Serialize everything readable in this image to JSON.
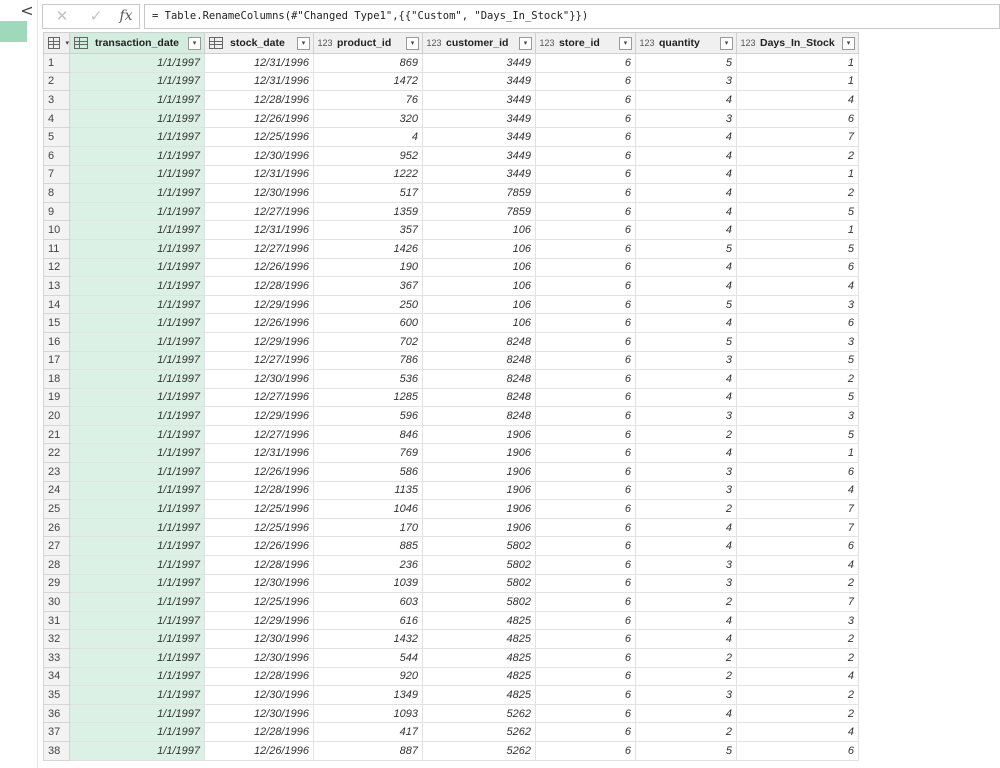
{
  "left_pane": {
    "collapse_glyph": "<"
  },
  "formula_bar": {
    "cancel_icon": "close-icon",
    "commit_icon": "check-icon",
    "fx_label": "fx",
    "formula": "= Table.RenameColumns(#\"Changed Type1\",{{\"Custom\", \"Days_In_Stock\"}})"
  },
  "columns": [
    {
      "name": "transaction_date",
      "type_icon": "date-table-icon"
    },
    {
      "name": "stock_date",
      "type_icon": "date-table-icon"
    },
    {
      "name": "product_id",
      "type_icon": "123"
    },
    {
      "name": "customer_id",
      "type_icon": "123"
    },
    {
      "name": "store_id",
      "type_icon": "123"
    },
    {
      "name": "quantity",
      "type_icon": "123"
    },
    {
      "name": "Days_In_Stock",
      "type_icon": "123"
    }
  ],
  "rows": [
    {
      "n": "1",
      "c": [
        "1/1/1997",
        "12/31/1996",
        "869",
        "3449",
        "6",
        "5",
        "1"
      ]
    },
    {
      "n": "2",
      "c": [
        "1/1/1997",
        "12/31/1996",
        "1472",
        "3449",
        "6",
        "3",
        "1"
      ]
    },
    {
      "n": "3",
      "c": [
        "1/1/1997",
        "12/28/1996",
        "76",
        "3449",
        "6",
        "4",
        "4"
      ]
    },
    {
      "n": "4",
      "c": [
        "1/1/1997",
        "12/26/1996",
        "320",
        "3449",
        "6",
        "3",
        "6"
      ]
    },
    {
      "n": "5",
      "c": [
        "1/1/1997",
        "12/25/1996",
        "4",
        "3449",
        "6",
        "4",
        "7"
      ]
    },
    {
      "n": "6",
      "c": [
        "1/1/1997",
        "12/30/1996",
        "952",
        "3449",
        "6",
        "4",
        "2"
      ]
    },
    {
      "n": "7",
      "c": [
        "1/1/1997",
        "12/31/1996",
        "1222",
        "3449",
        "6",
        "4",
        "1"
      ]
    },
    {
      "n": "8",
      "c": [
        "1/1/1997",
        "12/30/1996",
        "517",
        "7859",
        "6",
        "4",
        "2"
      ]
    },
    {
      "n": "9",
      "c": [
        "1/1/1997",
        "12/27/1996",
        "1359",
        "7859",
        "6",
        "4",
        "5"
      ]
    },
    {
      "n": "10",
      "c": [
        "1/1/1997",
        "12/31/1996",
        "357",
        "106",
        "6",
        "4",
        "1"
      ]
    },
    {
      "n": "11",
      "c": [
        "1/1/1997",
        "12/27/1996",
        "1426",
        "106",
        "6",
        "5",
        "5"
      ]
    },
    {
      "n": "12",
      "c": [
        "1/1/1997",
        "12/26/1996",
        "190",
        "106",
        "6",
        "4",
        "6"
      ]
    },
    {
      "n": "13",
      "c": [
        "1/1/1997",
        "12/28/1996",
        "367",
        "106",
        "6",
        "4",
        "4"
      ]
    },
    {
      "n": "14",
      "c": [
        "1/1/1997",
        "12/29/1996",
        "250",
        "106",
        "6",
        "5",
        "3"
      ]
    },
    {
      "n": "15",
      "c": [
        "1/1/1997",
        "12/26/1996",
        "600",
        "106",
        "6",
        "4",
        "6"
      ]
    },
    {
      "n": "16",
      "c": [
        "1/1/1997",
        "12/29/1996",
        "702",
        "8248",
        "6",
        "5",
        "3"
      ]
    },
    {
      "n": "17",
      "c": [
        "1/1/1997",
        "12/27/1996",
        "786",
        "8248",
        "6",
        "3",
        "5"
      ]
    },
    {
      "n": "18",
      "c": [
        "1/1/1997",
        "12/30/1996",
        "536",
        "8248",
        "6",
        "4",
        "2"
      ]
    },
    {
      "n": "19",
      "c": [
        "1/1/1997",
        "12/27/1996",
        "1285",
        "8248",
        "6",
        "4",
        "5"
      ]
    },
    {
      "n": "20",
      "c": [
        "1/1/1997",
        "12/29/1996",
        "596",
        "8248",
        "6",
        "3",
        "3"
      ]
    },
    {
      "n": "21",
      "c": [
        "1/1/1997",
        "12/27/1996",
        "846",
        "1906",
        "6",
        "2",
        "5"
      ]
    },
    {
      "n": "22",
      "c": [
        "1/1/1997",
        "12/31/1996",
        "769",
        "1906",
        "6",
        "4",
        "1"
      ]
    },
    {
      "n": "23",
      "c": [
        "1/1/1997",
        "12/26/1996",
        "586",
        "1906",
        "6",
        "3",
        "6"
      ]
    },
    {
      "n": "24",
      "c": [
        "1/1/1997",
        "12/28/1996",
        "1135",
        "1906",
        "6",
        "3",
        "4"
      ]
    },
    {
      "n": "25",
      "c": [
        "1/1/1997",
        "12/25/1996",
        "1046",
        "1906",
        "6",
        "2",
        "7"
      ]
    },
    {
      "n": "26",
      "c": [
        "1/1/1997",
        "12/25/1996",
        "170",
        "1906",
        "6",
        "4",
        "7"
      ]
    },
    {
      "n": "27",
      "c": [
        "1/1/1997",
        "12/26/1996",
        "885",
        "5802",
        "6",
        "4",
        "6"
      ]
    },
    {
      "n": "28",
      "c": [
        "1/1/1997",
        "12/28/1996",
        "236",
        "5802",
        "6",
        "3",
        "4"
      ]
    },
    {
      "n": "29",
      "c": [
        "1/1/1997",
        "12/30/1996",
        "1039",
        "5802",
        "6",
        "3",
        "2"
      ]
    },
    {
      "n": "30",
      "c": [
        "1/1/1997",
        "12/25/1996",
        "603",
        "5802",
        "6",
        "2",
        "7"
      ]
    },
    {
      "n": "31",
      "c": [
        "1/1/1997",
        "12/29/1996",
        "616",
        "4825",
        "6",
        "4",
        "3"
      ]
    },
    {
      "n": "32",
      "c": [
        "1/1/1997",
        "12/30/1996",
        "1432",
        "4825",
        "6",
        "4",
        "2"
      ]
    },
    {
      "n": "33",
      "c": [
        "1/1/1997",
        "12/30/1996",
        "544",
        "4825",
        "6",
        "2",
        "2"
      ]
    },
    {
      "n": "34",
      "c": [
        "1/1/1997",
        "12/28/1996",
        "920",
        "4825",
        "6",
        "2",
        "4"
      ]
    },
    {
      "n": "35",
      "c": [
        "1/1/1997",
        "12/30/1996",
        "1349",
        "4825",
        "6",
        "3",
        "2"
      ]
    },
    {
      "n": "36",
      "c": [
        "1/1/1997",
        "12/30/1996",
        "1093",
        "5262",
        "6",
        "4",
        "2"
      ]
    },
    {
      "n": "37",
      "c": [
        "1/1/1997",
        "12/28/1996",
        "417",
        "5262",
        "6",
        "2",
        "4"
      ]
    },
    {
      "n": "38",
      "c": [
        "1/1/1997",
        "12/26/1996",
        "887",
        "5262",
        "6",
        "5",
        "6"
      ]
    }
  ],
  "colors": {
    "selected_column": "#dcf1e5",
    "query_highlight": "#9fd9bb"
  }
}
